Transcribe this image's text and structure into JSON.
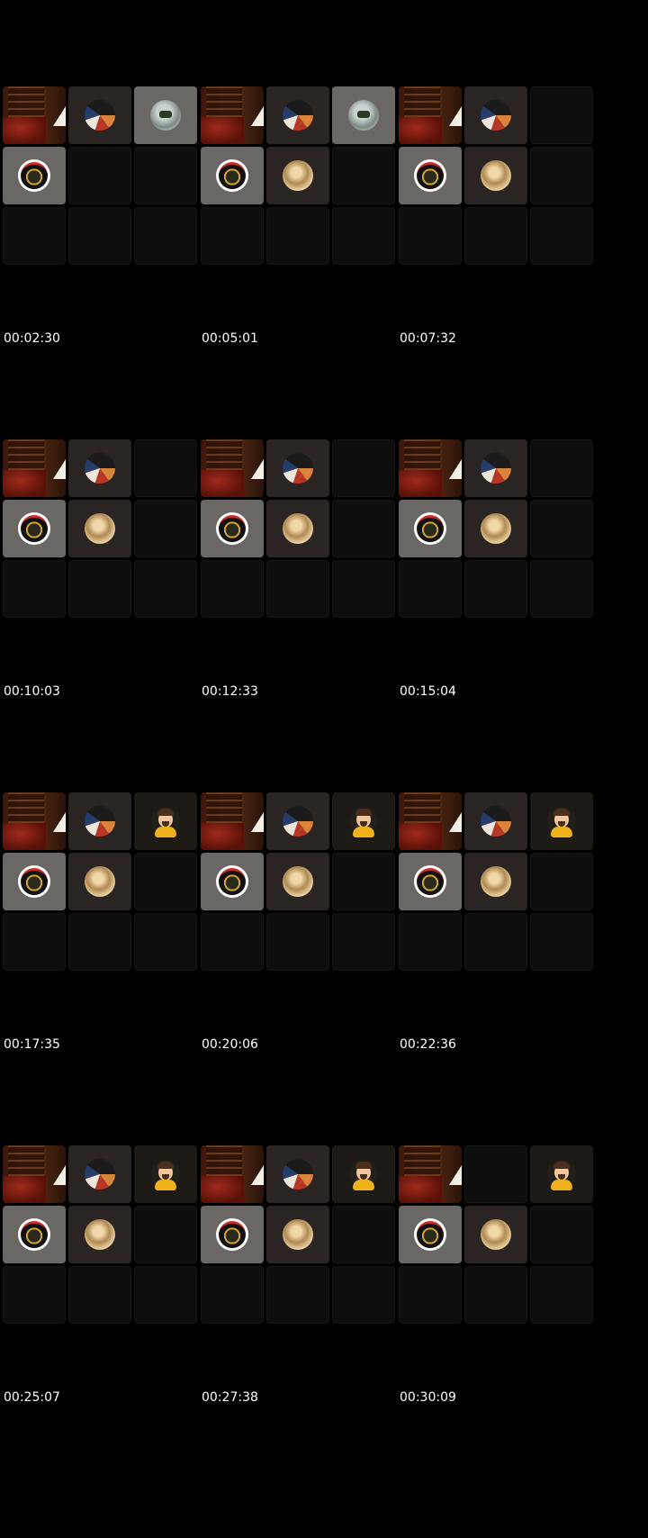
{
  "timestamps": [
    "00:02:30",
    "00:05:01",
    "00:07:32",
    "00:10:03",
    "00:12:33",
    "00:15:04",
    "00:17:35",
    "00:20:06",
    "00:22:36",
    "00:25:07",
    "00:27:38",
    "00:30:09"
  ],
  "tile_types": {
    "library": "library-scene",
    "guitar": "guitar-avatar",
    "photo": "photo-avatar",
    "badge": "badge-avatar",
    "coin": "coin-avatar",
    "man": "cartoon-man-avatar",
    "empty": "empty-tile"
  },
  "frames": [
    {
      "tiles": [
        "library",
        "guitar",
        "photo",
        "badge",
        "empty",
        "empty",
        "empty",
        "empty",
        "empty"
      ]
    },
    {
      "tiles": [
        "library",
        "guitar",
        "photo",
        "badge",
        "coin",
        "empty",
        "empty",
        "empty",
        "empty"
      ]
    },
    {
      "tiles": [
        "library",
        "guitar",
        "empty",
        "badge",
        "coin",
        "empty",
        "empty",
        "empty",
        "empty"
      ]
    },
    {
      "tiles": [
        "library",
        "guitar",
        "empty",
        "badge",
        "coin",
        "empty",
        "empty",
        "empty",
        "empty"
      ]
    },
    {
      "tiles": [
        "library",
        "guitar",
        "empty",
        "badge",
        "coin",
        "empty",
        "empty",
        "empty",
        "empty"
      ]
    },
    {
      "tiles": [
        "library",
        "guitar",
        "empty",
        "badge",
        "coin",
        "empty",
        "empty",
        "empty",
        "empty"
      ]
    },
    {
      "tiles": [
        "library",
        "guitar",
        "man",
        "badge",
        "coin",
        "empty",
        "empty",
        "empty",
        "empty"
      ]
    },
    {
      "tiles": [
        "library",
        "guitar",
        "man",
        "badge",
        "coin",
        "empty",
        "empty",
        "empty",
        "empty"
      ]
    },
    {
      "tiles": [
        "library",
        "guitar",
        "man",
        "badge",
        "coin",
        "empty",
        "empty",
        "empty",
        "empty"
      ]
    },
    {
      "tiles": [
        "library",
        "guitar",
        "man",
        "badge",
        "coin",
        "empty",
        "empty",
        "empty",
        "empty"
      ]
    },
    {
      "tiles": [
        "library",
        "guitar",
        "man",
        "badge",
        "coin",
        "empty",
        "empty",
        "empty",
        "empty"
      ]
    },
    {
      "tiles": [
        "library",
        "empty",
        "man",
        "badge",
        "coin",
        "empty",
        "empty",
        "empty",
        "empty"
      ]
    }
  ]
}
